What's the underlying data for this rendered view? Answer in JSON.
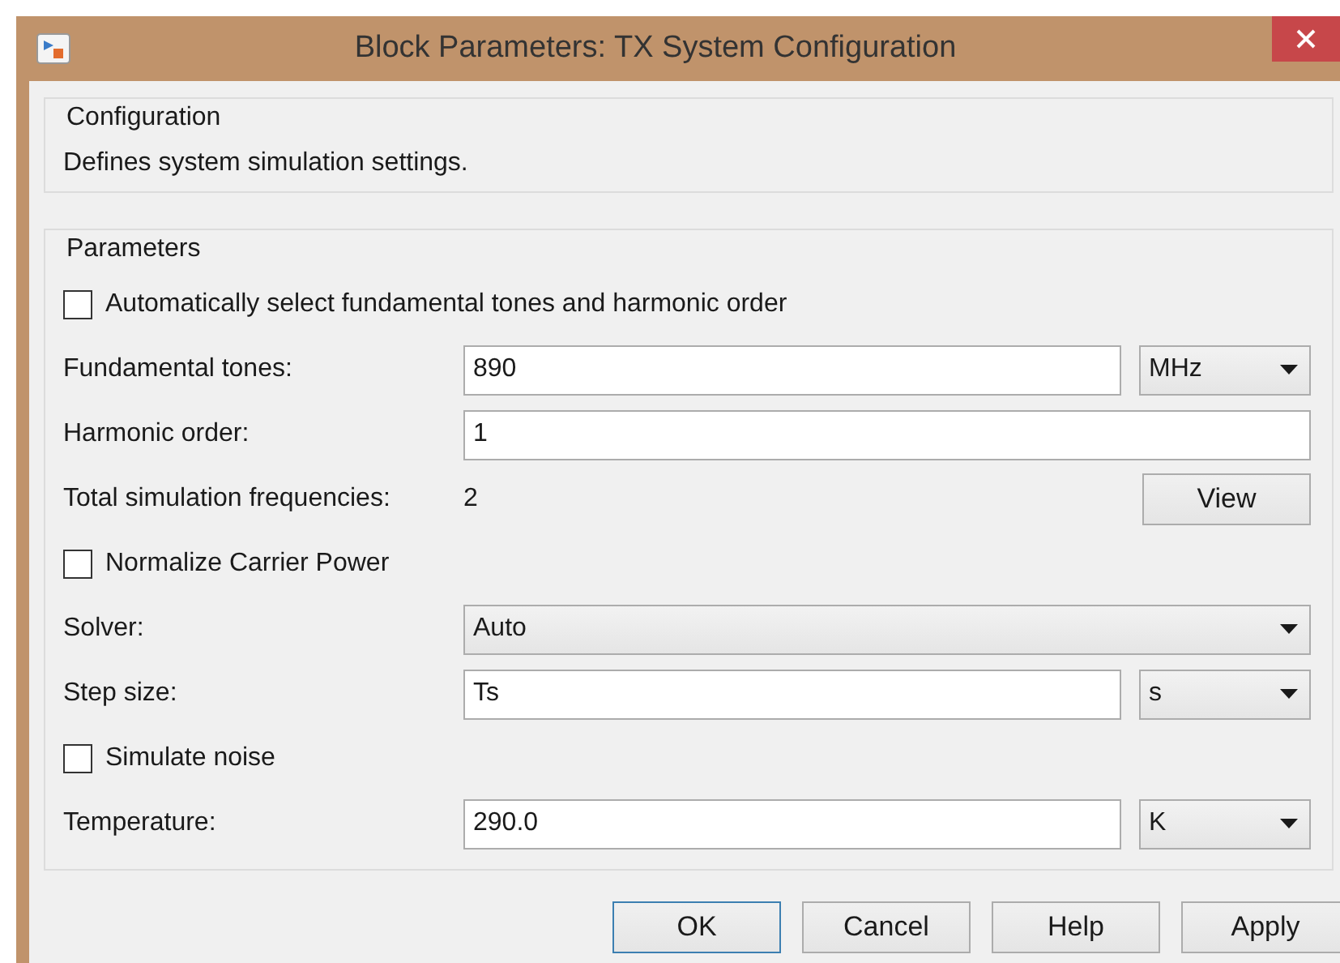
{
  "window": {
    "title": "Block Parameters: TX System Configuration"
  },
  "configuration": {
    "legend": "Configuration",
    "description": "Defines system simulation settings."
  },
  "parameters": {
    "legend": "Parameters",
    "rows": [
      {
        "kind": "checkbox",
        "label": "Automatically select fundamental tones and harmonic order",
        "checked": false
      },
      {
        "kind": "field",
        "label": "Fundamental tones:",
        "value": "890",
        "unit": "MHz"
      },
      {
        "kind": "field",
        "label": "Harmonic order:",
        "value": "1"
      },
      {
        "kind": "readout",
        "label": "Total simulation frequencies:",
        "value": "2",
        "button": "View"
      },
      {
        "kind": "checkbox",
        "label": "Normalize Carrier Power",
        "checked": false
      },
      {
        "kind": "dropdown",
        "label": "Solver:",
        "value": "Auto"
      },
      {
        "kind": "field",
        "label": "Step size:",
        "value": "Ts",
        "unit": "s"
      },
      {
        "kind": "checkbox",
        "label": "Simulate noise",
        "checked": false
      },
      {
        "kind": "field",
        "label": "Temperature:",
        "value": "290.0",
        "unit": "K"
      }
    ]
  },
  "buttons": [
    {
      "label": "OK",
      "default": true
    },
    {
      "label": "Cancel",
      "default": false
    },
    {
      "label": "Help",
      "default": false
    },
    {
      "label": "Apply",
      "default": false
    }
  ]
}
